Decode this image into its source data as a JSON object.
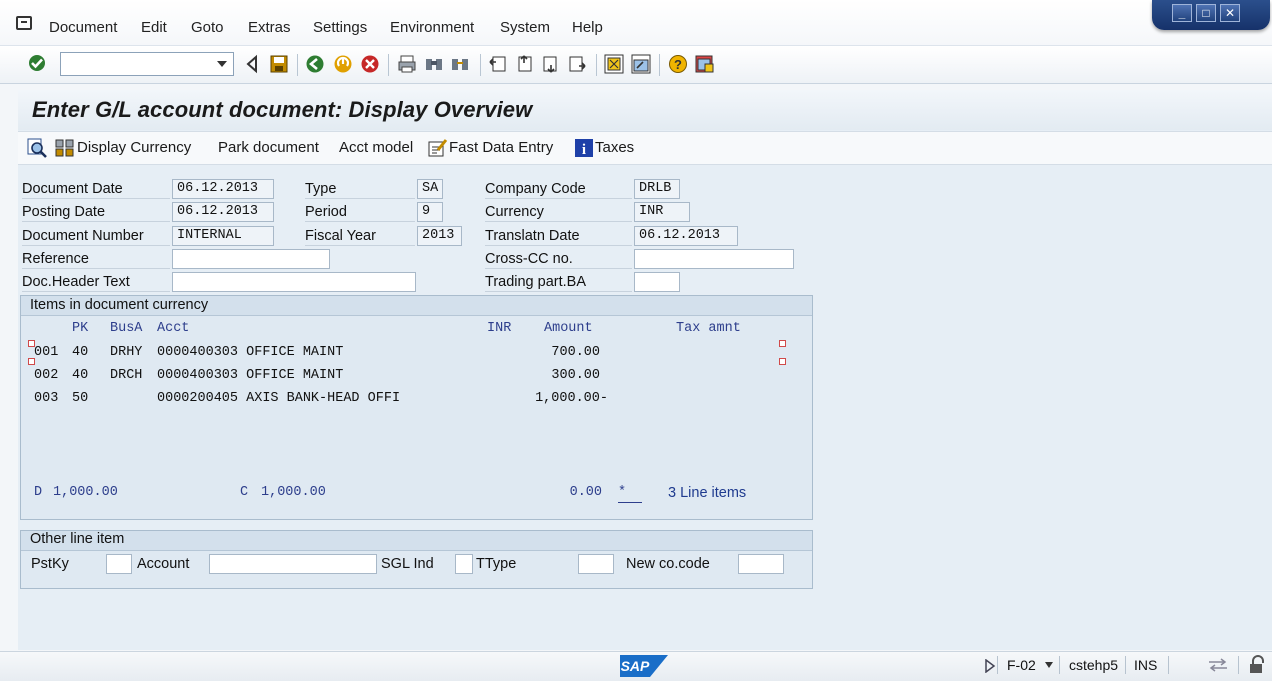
{
  "menu": [
    "Document",
    "Edit",
    "Goto",
    "Extras",
    "Settings",
    "Environment",
    "System",
    "Help"
  ],
  "window_controls": [
    "_",
    "□",
    "✕"
  ],
  "toolbar": {
    "command_field_value": "",
    "icons": [
      "enter-icon",
      "back-arrow-icon",
      "save-icon",
      "back-icon",
      "exit-icon",
      "cancel-icon",
      "print-icon",
      "find-icon",
      "find-next-icon",
      "first-page-icon",
      "previous-page-icon",
      "next-page-icon",
      "last-page-icon",
      "create-session-icon",
      "shortcut-icon",
      "help-icon",
      "customize-layout-icon"
    ]
  },
  "title": "Enter G/L account document: Display Overview",
  "app_toolbar": {
    "display_currency": "Display Currency",
    "park_document": "Park document",
    "acct_model": "Acct model",
    "fast_data_entry": "Fast Data Entry",
    "taxes": "Taxes"
  },
  "header": {
    "document_date": {
      "label": "Document Date",
      "value": "06.12.2013"
    },
    "posting_date": {
      "label": "Posting Date",
      "value": "06.12.2013"
    },
    "document_number": {
      "label": "Document Number",
      "value": "INTERNAL"
    },
    "reference": {
      "label": "Reference",
      "value": ""
    },
    "doc_header_text": {
      "label": "Doc.Header Text",
      "value": ""
    },
    "type": {
      "label": "Type",
      "value": "SA"
    },
    "period": {
      "label": "Period",
      "value": "9"
    },
    "fiscal_year": {
      "label": "Fiscal Year",
      "value": "2013"
    },
    "company_code": {
      "label": "Company Code",
      "value": "DRLB"
    },
    "currency": {
      "label": "Currency",
      "value": "INR"
    },
    "translatn_date": {
      "label": "Translatn Date",
      "value": "06.12.2013"
    },
    "cross_cc_no": {
      "label": "Cross-CC no.",
      "value": ""
    },
    "trading_part_ba": {
      "label": "Trading part.BA",
      "value": ""
    }
  },
  "items": {
    "group_title": "Items in document currency",
    "columns": {
      "pk": "PK",
      "busa": "BusA",
      "acct": "Acct",
      "inr": "INR",
      "amount": "Amount",
      "tax_amnt": "Tax amnt"
    },
    "rows": [
      {
        "no": "001",
        "pk": "40",
        "busa": "DRHY",
        "acct": "0000400303 OFFICE MAINT",
        "amount": "700.00"
      },
      {
        "no": "002",
        "pk": "40",
        "busa": "DRCH",
        "acct": "0000400303 OFFICE MAINT",
        "amount": "300.00"
      },
      {
        "no": "003",
        "pk": "50",
        "busa": "",
        "acct": "0000200405 AXIS BANK-HEAD OFFI",
        "amount": "1,000.00-"
      }
    ],
    "totals": {
      "debit_label": "D",
      "debit": "1,000.00",
      "credit_label": "C",
      "credit": "1,000.00",
      "balance": "0.00",
      "balance_flag": "*",
      "line_items": "3 Line items"
    }
  },
  "other_line_item": {
    "group_title": "Other line item",
    "pstky_label": "PstKy",
    "pstky_value": "",
    "account_label": "Account",
    "account_value": "",
    "sgl_ind_label": "SGL Ind",
    "sgl_ind_value": "",
    "ttype_label": "TType",
    "ttype_value": "",
    "new_cocode_label": "New co.code",
    "new_cocode_value": ""
  },
  "status_bar": {
    "logo": "SAP",
    "transaction": "F-02",
    "server": "cstehp5",
    "mode": "INS"
  },
  "colors": {
    "title_bg": "#e3ebf2",
    "group_bg": "#dfe9f2",
    "column_header_text": "#2d3e8c",
    "window_controls": "#1e3f7a"
  }
}
